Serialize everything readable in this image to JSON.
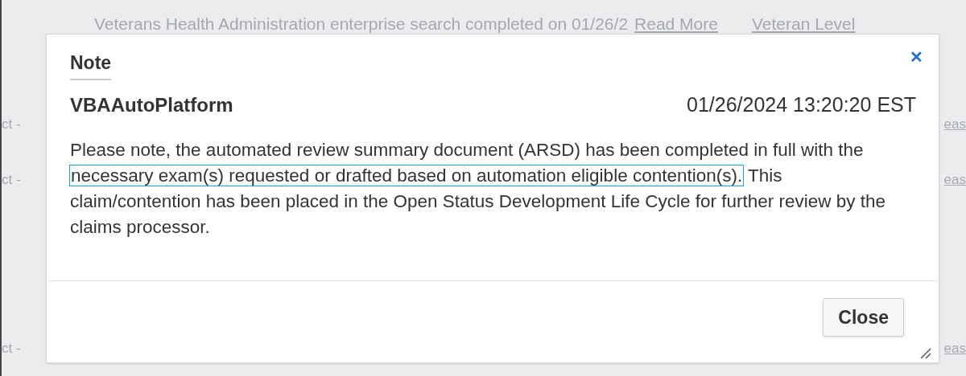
{
  "page": {
    "banner": "Veterans Health Administration enterprise search completed on 01/26/2",
    "banner_link": "Read More",
    "level_link": "Veteran Level",
    "left_fragments": [
      "ct -",
      "ct -",
      "ct -"
    ],
    "right_fragments": [
      "eas",
      "eas",
      "eas"
    ]
  },
  "dialog": {
    "title": "Note",
    "close_icon": "✕",
    "author": "VBAAutoPlatform",
    "timestamp": "01/26/2024 13:20:20 EST",
    "body": [
      {
        "text": "Please note, the automated review summary document (ARSD) has been completed in full with the ",
        "highlighted": false
      },
      {
        "text": "necessary exam(s) requested or drafted based on automation eligible contention(s).",
        "highlighted": true
      },
      {
        "text": " This claim/contention has been placed in the Open Status Development Life Cycle for further review by the claims processor.",
        "highlighted": false
      }
    ],
    "buttons": [
      "Close"
    ]
  }
}
